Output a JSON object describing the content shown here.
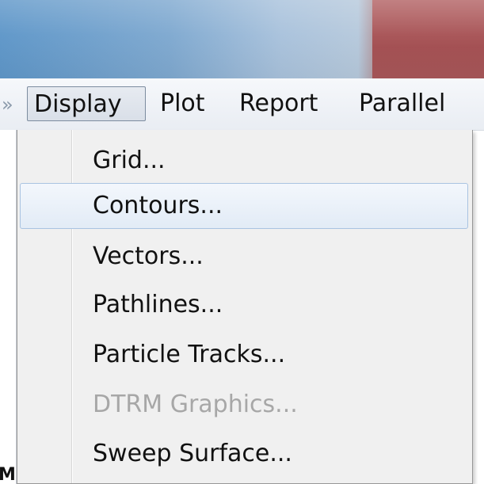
{
  "menubar": {
    "chevron": "»",
    "items": [
      {
        "label": "Display"
      },
      {
        "label": "Plot"
      },
      {
        "label": "Report"
      },
      {
        "label": "Parallel"
      }
    ]
  },
  "dropdown": {
    "items": [
      {
        "label": "Grid..."
      },
      {
        "label": "Contours..."
      },
      {
        "label": "Vectors..."
      },
      {
        "label": "Pathlines..."
      },
      {
        "label": "Particle Tracks..."
      },
      {
        "label": "DTRM Graphics..."
      },
      {
        "label": "Sweep Surface..."
      }
    ],
    "highlighted_label": "Contours...",
    "disabled_label": "DTRM Graphics..."
  },
  "canvas": {
    "glyph": "M"
  },
  "colors": {
    "title_bar_blue": "#7fa9d0",
    "close_button_red": "#a44f52",
    "menu_background": "#f0f0f0",
    "highlight_border": "#a9c3e1",
    "disabled_text": "#a7a7a7"
  }
}
